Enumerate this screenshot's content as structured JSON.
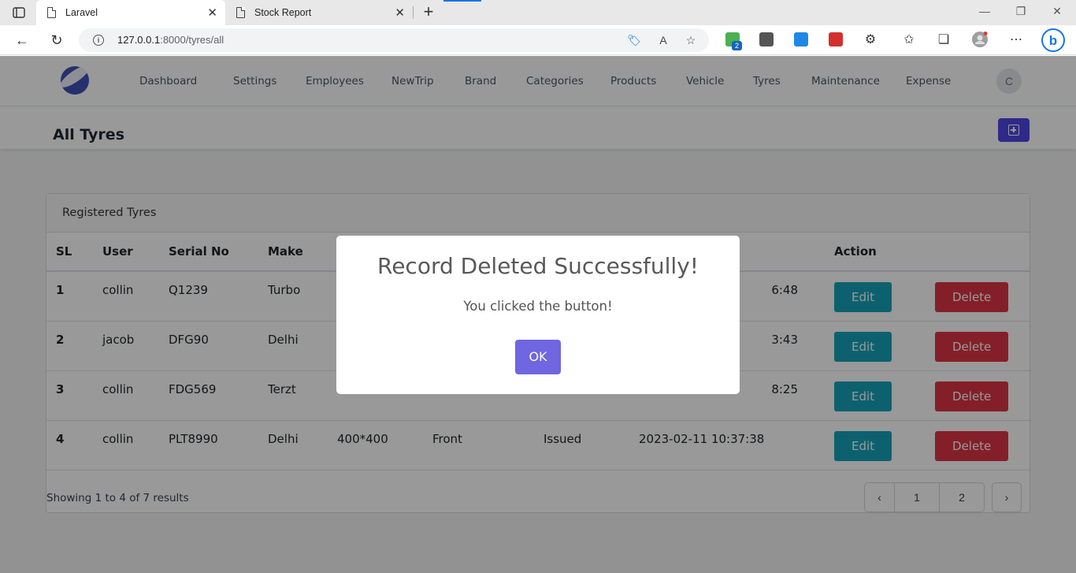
{
  "browser": {
    "tabs": [
      {
        "title": "Laravel",
        "active": true
      },
      {
        "title": "Stock Report",
        "active": false
      }
    ],
    "url_host": "127.0.0.1",
    "url_port_path": ":8000/tyres/all",
    "extension_badge": "2"
  },
  "nav": {
    "links": [
      "Dashboard",
      "Settings",
      "Employees",
      "NewTrip",
      "Brand",
      "Categories",
      "Products",
      "Vehicle",
      "Tyres",
      "Maintenance",
      "Expense"
    ],
    "avatar_initial": "C"
  },
  "page": {
    "title": "All Tyres"
  },
  "card": {
    "header": "Registered Tyres",
    "columns": [
      "SL",
      "User",
      "Serial No",
      "Make",
      "",
      "",
      "",
      "",
      "Action"
    ],
    "rows": [
      {
        "sl": "1",
        "user": "collin",
        "serial": "Q1239",
        "make": "Turbo",
        "size": "",
        "position": "",
        "status": "",
        "date": "6:48"
      },
      {
        "sl": "2",
        "user": "jacob",
        "serial": "DFG90",
        "make": "Delhi",
        "size": "",
        "position": "",
        "status": "",
        "date": "3:43"
      },
      {
        "sl": "3",
        "user": "collin",
        "serial": "FDG569",
        "make": "Terzt",
        "size": "",
        "position": "",
        "status": "",
        "date": "8:25"
      },
      {
        "sl": "4",
        "user": "collin",
        "serial": "PLT8990",
        "make": "Delhi",
        "size": "400*400",
        "position": "Front",
        "status": "Issued",
        "date": "2023-02-11 10:37:38"
      }
    ],
    "edit_label": "Edit",
    "delete_label": "Delete",
    "showing": "Showing 1 to 4 of 7 results",
    "pages": [
      "1",
      "2"
    ]
  },
  "modal": {
    "title": "Record Deleted Successfully!",
    "text": "You clicked the button!",
    "ok_label": "OK"
  },
  "colors": {
    "accent": "#4f46e5",
    "edit": "#17a2b8",
    "delete": "#dc3545",
    "confirm": "#7066e0"
  }
}
